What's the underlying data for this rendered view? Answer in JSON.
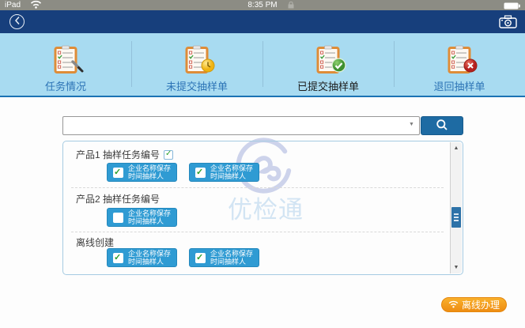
{
  "status_bar": {
    "device_label": "iPad",
    "time": "8:35 PM"
  },
  "header": {
    "back_icon": "chevron-left-circle",
    "camera_icon": "camera"
  },
  "tab_bar": {
    "selected_tab": "已提交抽样单",
    "tabs": [
      {
        "label": "任务情况",
        "icon": "clipboard-pencil-icon",
        "selected": false
      },
      {
        "label": "未提交抽样单",
        "icon": "clipboard-clock-icon",
        "selected": false
      },
      {
        "label": "已提交抽样单",
        "icon": "clipboard-check-icon",
        "selected": true
      },
      {
        "label": "退回抽样单",
        "icon": "clipboard-cross-icon",
        "selected": false
      }
    ]
  },
  "search": {
    "value": "",
    "placeholder": "",
    "dropdown_icon": "▼",
    "button_icon": "magnifier"
  },
  "panel": {
    "sections": [
      {
        "title": "产品1 抽样任务编号",
        "title_checkbox": true,
        "title_checked": true,
        "buttons": [
          {
            "checked": true
          },
          {
            "checked": true
          }
        ]
      },
      {
        "title": "产品2 抽样任务编号",
        "title_checkbox": false,
        "buttons": [
          {
            "checked": false
          }
        ]
      },
      {
        "title": "离线创建",
        "title_checkbox": false,
        "buttons": [
          {
            "checked": true
          },
          {
            "checked": true
          }
        ]
      }
    ],
    "action_button_label": [
      "企业名称保存",
      "时间抽样人"
    ],
    "scrollbar": {
      "up_icon": "▲",
      "down_icon": "▼"
    }
  },
  "watermark": {
    "text": "优检通"
  },
  "offline_button": {
    "label": "离线办理",
    "icon": "wifi"
  },
  "colors": {
    "status_bar": "#8c8c84",
    "header": "#173f7c",
    "tab_bar": "#a8dbf1",
    "tab_text": "#2d74b6",
    "tab_selected_text": "#1c1c1c",
    "accent_line": "#1b73b4",
    "search_button": "#1e6ba3",
    "action_button": "#2f9bd3",
    "orange_button": "#f29a1b",
    "check_green": "#2da02d",
    "watermark_blue": "#d2e4f3"
  }
}
